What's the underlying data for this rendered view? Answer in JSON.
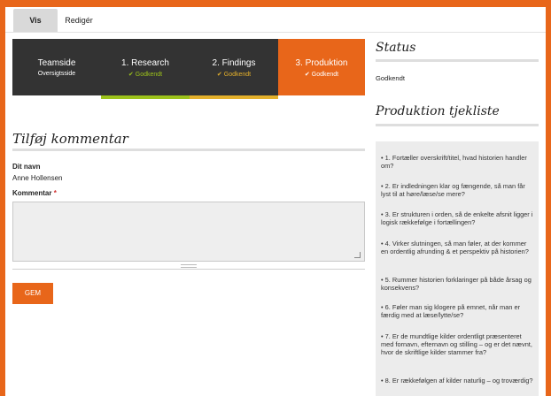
{
  "tabs": {
    "view": "Vis",
    "edit": "Redigér"
  },
  "steps": [
    {
      "title": "Teamside",
      "sub": "Oversigtsside"
    },
    {
      "title": "1. Research",
      "sub": "Godkendt",
      "check": "✔"
    },
    {
      "title": "2. Findings",
      "sub": "Godkendt",
      "check": "✔"
    },
    {
      "title": "3. Produktion",
      "sub": "Godkendt",
      "check": "✔"
    }
  ],
  "comment": {
    "title": "Tilføj kommentar",
    "name_label": "Dit navn",
    "name_value": "Anne Hollensen",
    "comment_label": "Kommentar",
    "required_mark": "*",
    "submit": "GEM"
  },
  "status": {
    "title": "Status",
    "value": "Godkendt"
  },
  "checklist": {
    "title": "Produktion tjekliste",
    "bullet": "•",
    "items": [
      "1. Fortæller overskrift/titel, hvad historien handler om?",
      "2. Er indledningen klar og fængende, så man får lyst til at høre/læse/se mere?",
      "3. Er strukturen i orden, så de enkelte afsnit ligger i logisk rækkefølge i fortællingen?",
      "4. Virker slutningen, så man føler, at der kommer en ordentlig afrunding & et perspektiv på historien?",
      "5. Rummer historien forklaringer på både årsag og konsekvens?",
      "6. Føler man sig klogere på emnet, når man er færdig med at læse/lytte/se?",
      "7. Er de mundtlige kilder ordentligt præsenteret med fornavn, efternavn og stilling – og er det nævnt, hvor de skriftlige kilder stammer fra?",
      "8. Er rækkefølgen af kilder naturlig – og troværdig?"
    ]
  },
  "colors": {
    "accent": "#e8661a",
    "dark": "#333333",
    "green": "#9cc21b",
    "yellow": "#e4b02b"
  }
}
